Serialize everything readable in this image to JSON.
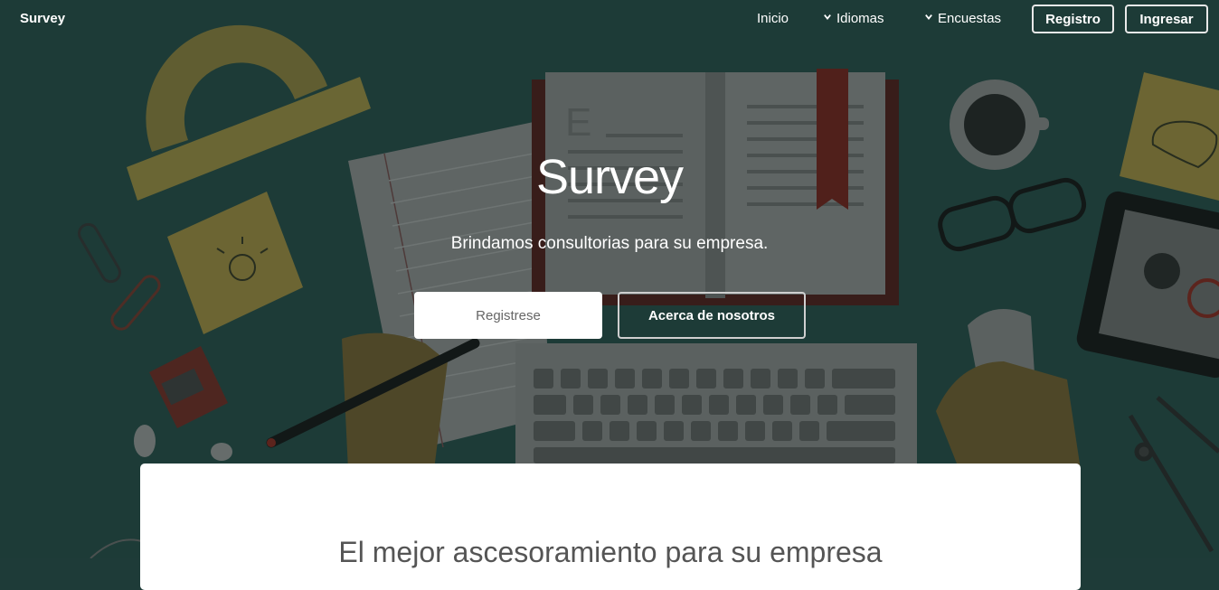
{
  "nav": {
    "brand": "Survey",
    "items": [
      {
        "label": "Inicio",
        "icon": null
      },
      {
        "label": "Idiomas",
        "icon": "chevron-down-icon"
      },
      {
        "label": "Encuestas",
        "icon": "chevron-down-icon"
      }
    ],
    "register_label": "Registro",
    "login_label": "Ingresar"
  },
  "hero": {
    "title": "Survey",
    "subtitle": "Brindamos consultorias para su empresa.",
    "primary_button": "Registrese",
    "secondary_button": "Acerca de nosotros",
    "background_color": "#1e3b38"
  },
  "card": {
    "title": "El mejor ascesoramiento para su empresa"
  },
  "colors": {
    "overlay": "#1e3b38",
    "ruler": "#8a7a3a",
    "note": "#8f7d36",
    "book_cover": "#4a1a16",
    "bookmark": "#6b1f18"
  }
}
